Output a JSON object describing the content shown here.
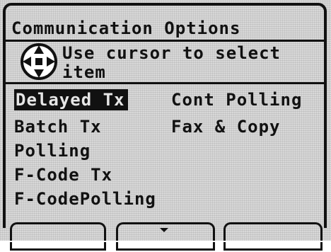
{
  "screen": {
    "title": "Communication Options",
    "hint": {
      "line1": "Use cursor to select",
      "line2": "item"
    }
  },
  "options": {
    "col1": [
      "Delayed Tx",
      "Batch Tx",
      "Polling",
      "F-Code Tx",
      "F-CodePolling"
    ],
    "col2": [
      "Cont Polling",
      "Fax & Copy"
    ],
    "selected": "Delayed Tx"
  },
  "icons": {
    "cursor": "cursor-keys-icon",
    "softkey_arrow": "down-arrow-icon"
  },
  "colors": {
    "background": "#d8d8d8",
    "ink": "#111111",
    "selected_text": "#e6e6e6"
  }
}
